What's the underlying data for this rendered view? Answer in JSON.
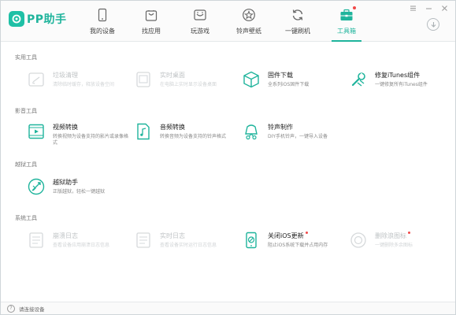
{
  "app": {
    "brand": "PP助手",
    "accent_color": "#1fb49c"
  },
  "nav": {
    "items": [
      {
        "label": "我的设备",
        "icon": "phone-icon"
      },
      {
        "label": "找应用",
        "icon": "shopping-bag-icon"
      },
      {
        "label": "玩游戏",
        "icon": "gamepad-icon"
      },
      {
        "label": "铃声壁纸",
        "icon": "star-icon"
      },
      {
        "label": "一键刷机",
        "icon": "refresh-icon"
      },
      {
        "label": "工具箱",
        "icon": "toolbox-icon",
        "active": true
      }
    ]
  },
  "sections": {
    "practical": "实用工具",
    "media": "影音工具",
    "jailbreak": "越狱工具",
    "system": "系统工具"
  },
  "tools": {
    "junk_clean": {
      "name": "垃圾清理",
      "desc": "清除临时缓存，释放设备空间",
      "enabled": false
    },
    "realtime_desktop": {
      "name": "实时桌面",
      "desc": "在电脑上实时显示设备桌面",
      "enabled": false
    },
    "firmware_download": {
      "name": "固件下载",
      "desc": "全系列iOS固件下载",
      "enabled": true
    },
    "fix_itunes": {
      "name": "修复iTunes组件",
      "desc": "一键修复所有iTunes组件",
      "enabled": true
    },
    "video_convert": {
      "name": "视频转换",
      "desc": "转换视频为设备支持的影片或录像格式",
      "enabled": true
    },
    "audio_convert": {
      "name": "音频转换",
      "desc": "转换音频为设备支持的铃声格式",
      "enabled": true
    },
    "ringtone_make": {
      "name": "铃声制作",
      "desc": "DIY手机铃声，一键导入设备",
      "enabled": true
    },
    "jailbreak_helper": {
      "name": "越狱助手",
      "desc": "正版越狱，轻松一键越狱",
      "enabled": true
    },
    "crash_log": {
      "name": "崩溃日志",
      "desc": "查看设备应用崩溃日志信息",
      "enabled": false
    },
    "realtime_log": {
      "name": "实时日志",
      "desc": "查看设备实时运行日志信息",
      "enabled": false
    },
    "close_ios_update": {
      "name": "关闭iOS更新",
      "desc": "阻止iOS系统下载并占用内存",
      "enabled": true,
      "dot": true
    },
    "remove_icon": {
      "name": "删除浪图标",
      "desc": "一键删除多余图标",
      "enabled": false,
      "dot": true
    }
  },
  "footer": {
    "status": "请连接设备"
  }
}
